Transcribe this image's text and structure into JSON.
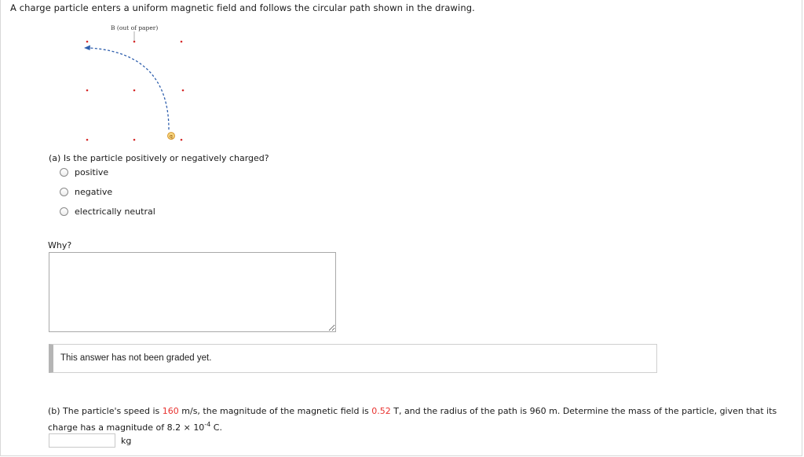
{
  "problem": {
    "intro": "A charge particle enters a uniform magnetic field and follows the circular path shown in the drawing."
  },
  "figure": {
    "field_label": "B (out of paper)",
    "particle_symbol": "q",
    "colors": {
      "dots": "#d62b2b",
      "path": "#2f5fad",
      "particle_fill": "#f5d27a",
      "particle_stroke": "#d08a1c"
    }
  },
  "part_a": {
    "question": "(a) Is the particle positively or negatively charged?",
    "options": [
      "positive",
      "negative",
      "electrically neutral"
    ],
    "why_label": "Why?",
    "why_value": "",
    "grade_status": "This answer has not been graded yet."
  },
  "part_b": {
    "text_1": "(b) The particle's speed is ",
    "speed": "160",
    "text_2": " m/s, the magnitude of the magnetic field is ",
    "field": "0.52",
    "text_3": " T, and the radius of the path is 960 m. Determine the mass of the particle, given that its charge has a magnitude of 8.2 × 10",
    "exponent": "-4",
    "text_4": " C.",
    "answer_value": "",
    "unit": "kg"
  }
}
